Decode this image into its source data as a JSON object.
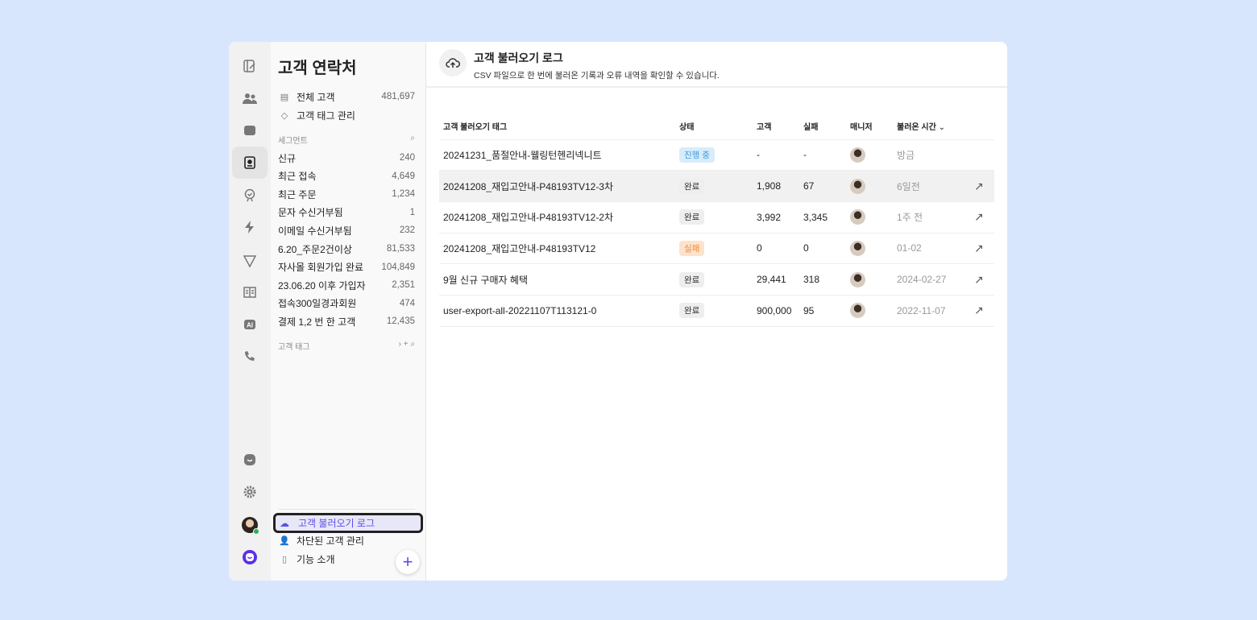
{
  "sidebar": {
    "title": "고객 연락처",
    "top_items": [
      {
        "label": "전체 고객",
        "count": "481,697"
      },
      {
        "label": "고객 태그 관리"
      }
    ],
    "segment_header": "세그먼트",
    "segments": [
      {
        "label": "신규",
        "count": "240"
      },
      {
        "label": "최근 접속",
        "count": "4,649"
      },
      {
        "label": "최근 주문",
        "count": "1,234"
      },
      {
        "label": "문자 수신거부됨",
        "count": "1"
      },
      {
        "label": "이메일 수신거부됨",
        "count": "232"
      },
      {
        "label": "6.20_주문2건이상",
        "count": "81,533"
      },
      {
        "label": "자사몰 회원가입 완료",
        "count": "104,849"
      },
      {
        "label": "23.06.20 이후 가입자",
        "count": "2,351"
      },
      {
        "label": "접속300일경과회원",
        "count": "474"
      },
      {
        "label": "결제 1,2 번 한 고객",
        "count": "12,435"
      }
    ],
    "tag_header": "고객 태그",
    "bottom_items": [
      {
        "label": "고객 불러오기 로그"
      },
      {
        "label": "차단된 고객 관리"
      },
      {
        "label": "기능 소개"
      }
    ]
  },
  "header": {
    "title": "고객 불러오기 로그",
    "subtitle": "CSV 파일으로 한 번에 불러온 기록과 오류 내역을 확인할 수 있습니다."
  },
  "table": {
    "columns": [
      "고객 불러오기 태그",
      "상태",
      "고객",
      "실패",
      "매니저",
      "불러온 시간"
    ],
    "rows": [
      {
        "tag": "20241231_품절안내-웰링턴헨리넥니트",
        "status": "진행 중",
        "customers": "-",
        "failed": "-",
        "time": "방금"
      },
      {
        "tag": "20241208_재입고안내-P48193TV12-3차",
        "status": "완료",
        "customers": "1,908",
        "failed": "67",
        "time": "6일전"
      },
      {
        "tag": "20241208_재입고안내-P48193TV12-2차",
        "status": "완료",
        "customers": "3,992",
        "failed": "3,345",
        "time": "1주 전"
      },
      {
        "tag": "20241208_재입고안내-P48193TV12",
        "status": "실패",
        "customers": "0",
        "failed": "0",
        "time": "01-02"
      },
      {
        "tag": "9월 신규 구매자 혜택",
        "status": "완료",
        "customers": "29,441",
        "failed": "318",
        "time": "2024-02-27"
      },
      {
        "tag": "user-export-all-20221107T113121-0",
        "status": "완료",
        "customers": "900,000",
        "failed": "95",
        "time": "2022-11-07"
      }
    ]
  },
  "colors": {
    "accent": "#5b4ee8",
    "background": "#d8e6fd"
  }
}
